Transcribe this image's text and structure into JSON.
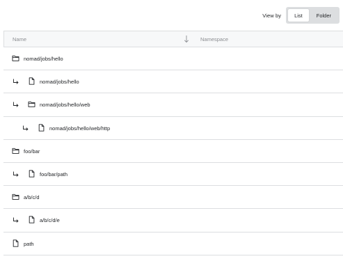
{
  "toolbar": {
    "view_by_label": "View by",
    "options": [
      "List",
      "Folder"
    ],
    "selected": "List"
  },
  "table": {
    "columns": [
      "Name",
      "Namespace"
    ],
    "sort_icon": "arrow-down-icon",
    "rows": [
      {
        "name": "nomad/jobs/hello",
        "type": "folder",
        "depth": 0,
        "namespace": ""
      },
      {
        "name": "nomad/jobs/hello",
        "type": "file",
        "depth": 1,
        "namespace": ""
      },
      {
        "name": "nomad/jobs/hello/web",
        "type": "folder",
        "depth": 1,
        "namespace": ""
      },
      {
        "name": "nomad/jobs/hello/web/http",
        "type": "file",
        "depth": 2,
        "namespace": ""
      },
      {
        "name": "foo/bar",
        "type": "folder",
        "depth": 0,
        "namespace": ""
      },
      {
        "name": "foo/bar/path",
        "type": "file",
        "depth": 1,
        "namespace": ""
      },
      {
        "name": "a/b/c/d",
        "type": "folder",
        "depth": 0,
        "namespace": ""
      },
      {
        "name": "a/b/c/d/e",
        "type": "file",
        "depth": 1,
        "namespace": ""
      },
      {
        "name": "path",
        "type": "file",
        "depth": 0,
        "namespace": ""
      }
    ]
  }
}
